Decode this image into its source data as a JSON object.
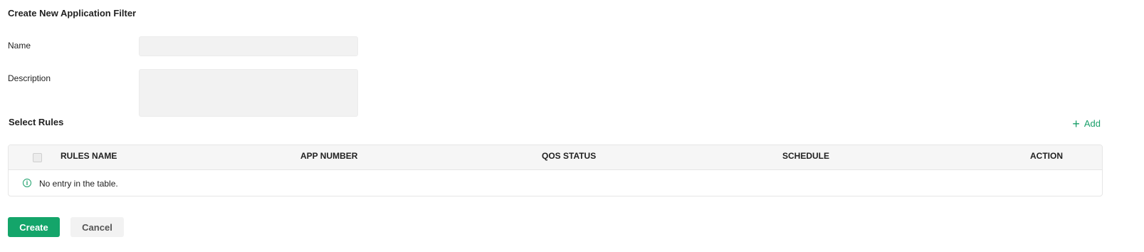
{
  "page": {
    "title": "Create New Application Filter"
  },
  "form": {
    "name_label": "Name",
    "name_value": "",
    "description_label": "Description",
    "description_value": ""
  },
  "rules": {
    "section_title": "Select Rules",
    "add_label": "Add",
    "columns": [
      "RULES NAME",
      "APP NUMBER",
      "QOS STATUS",
      "SCHEDULE",
      "ACTION"
    ],
    "empty_message": "No entry in the table."
  },
  "buttons": {
    "create_label": "Create",
    "cancel_label": "Cancel"
  },
  "colors": {
    "accent": "#14a56a",
    "input_background": "#f2f2f2",
    "table_header_background": "#f6f6f6"
  },
  "icons": {
    "add": "plus-icon",
    "info": "info-circle-icon"
  }
}
